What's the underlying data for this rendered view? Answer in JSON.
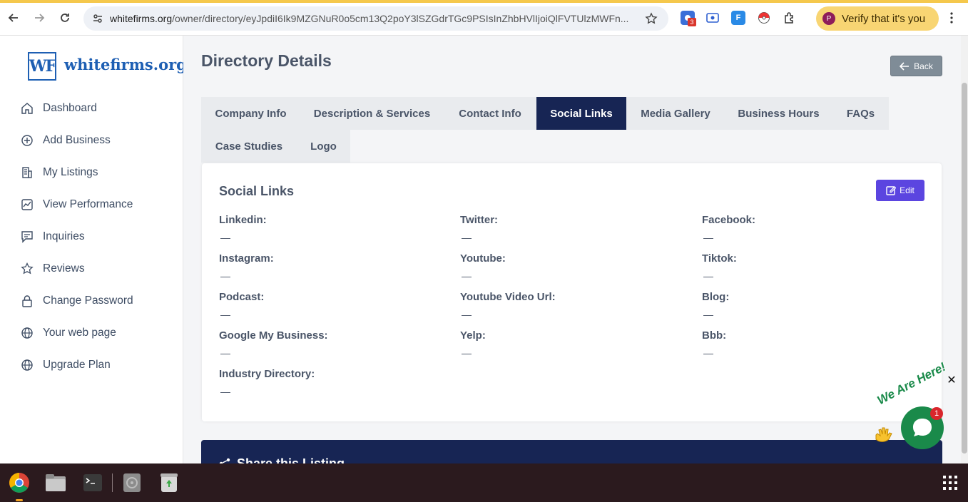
{
  "browser": {
    "url_domain": "whitefirms.org",
    "url_path": "/owner/directory/eyJpdiI6Ik9MZGNuR0o5cm13Q2poY3lSZGdrTGc9PSIsInZhbHVlIjoiQlFVTUlzMWFn...",
    "extension_badge": "3",
    "profile_initial": "P",
    "verify_label": "Verify that it's you"
  },
  "sidebar": {
    "logo_mark": "WF",
    "logo_text": "whitefirms.org",
    "items": [
      {
        "label": "Dashboard",
        "icon": "home-icon"
      },
      {
        "label": "Add Business",
        "icon": "plus-circle-icon"
      },
      {
        "label": "My Listings",
        "icon": "building-icon"
      },
      {
        "label": "View Performance",
        "icon": "chart-icon"
      },
      {
        "label": "Inquiries",
        "icon": "message-icon"
      },
      {
        "label": "Reviews",
        "icon": "star-icon"
      },
      {
        "label": "Change Password",
        "icon": "lock-icon"
      },
      {
        "label": "Your web page",
        "icon": "globe-icon"
      },
      {
        "label": "Upgrade Plan",
        "icon": "globe-icon"
      }
    ]
  },
  "main": {
    "title": "Directory Details",
    "back_label": "Back",
    "tabs": [
      {
        "label": "Company Info"
      },
      {
        "label": "Description & Services"
      },
      {
        "label": "Contact Info"
      },
      {
        "label": "Social Links",
        "active": true
      },
      {
        "label": "Media Gallery"
      },
      {
        "label": "Business Hours"
      },
      {
        "label": "FAQs"
      },
      {
        "label": "Case Studies"
      },
      {
        "label": "Logo"
      }
    ],
    "card": {
      "title": "Social Links",
      "edit_label": "Edit",
      "fields": [
        {
          "label": "Linkedin:",
          "value": "—"
        },
        {
          "label": "Twitter:",
          "value": "—"
        },
        {
          "label": "Facebook:",
          "value": "—"
        },
        {
          "label": "Instagram:",
          "value": "—"
        },
        {
          "label": "Youtube:",
          "value": "—"
        },
        {
          "label": "Tiktok:",
          "value": "—"
        },
        {
          "label": "Podcast:",
          "value": "—"
        },
        {
          "label": "Youtube Video Url:",
          "value": "—"
        },
        {
          "label": "Blog:",
          "value": "—"
        },
        {
          "label": "Google My Business:",
          "value": "—"
        },
        {
          "label": "Yelp:",
          "value": "—"
        },
        {
          "label": "Bbb:",
          "value": "—"
        },
        {
          "label": "Industry Directory:",
          "value": "—"
        }
      ]
    },
    "share_title": "Share this Listing"
  },
  "chat": {
    "banner": "We Are Here!",
    "badge_count": "1",
    "close_glyph": "✕"
  },
  "colors": {
    "accent_navy": "#172554",
    "edit_purple": "#5b45e0",
    "brand_blue": "#1e5fb3",
    "chat_green": "#1a8a4a"
  }
}
